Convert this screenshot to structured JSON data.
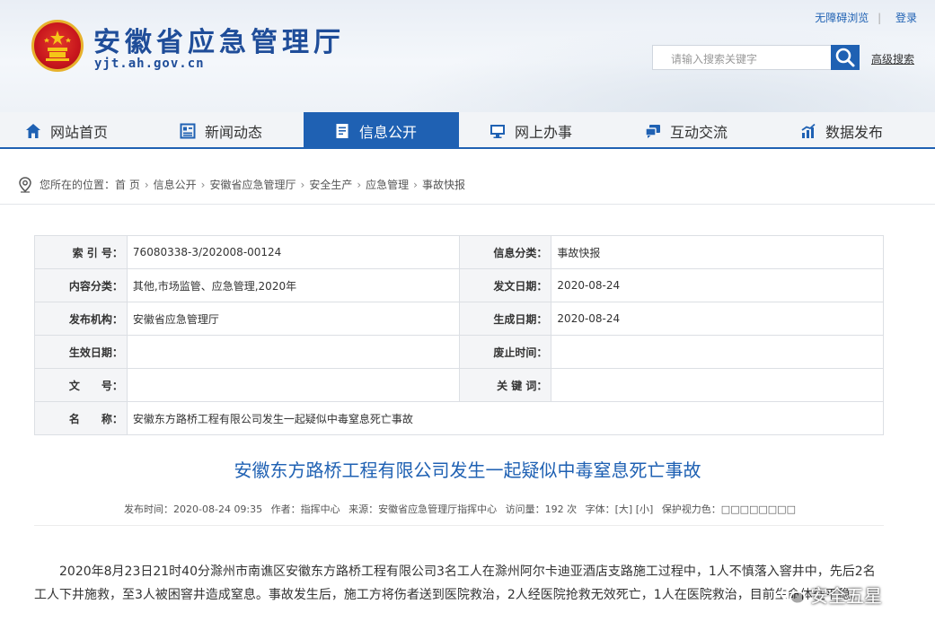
{
  "header": {
    "site_title": "安徽省应急管理厅",
    "site_url": "yjt.ah.gov.cn",
    "top_links": [
      "无障碍浏览",
      "登录"
    ],
    "search_placeholder": "请输入搜索关键字",
    "advanced_search": "高级搜索",
    "brand_color": "#1f61b3"
  },
  "nav": {
    "items": [
      {
        "label": "网站首页",
        "icon": "home-icon"
      },
      {
        "label": "新闻动态",
        "icon": "news-icon"
      },
      {
        "label": "信息公开",
        "icon": "document-icon",
        "active": true
      },
      {
        "label": "网上办事",
        "icon": "monitor-icon"
      },
      {
        "label": "互动交流",
        "icon": "chat-icon"
      },
      {
        "label": "数据发布",
        "icon": "chart-icon"
      }
    ]
  },
  "breadcrumb": {
    "prefix": "您所在的位置：",
    "items": [
      "首 页",
      "信息公开",
      "安徽省应急管理厅",
      "安全生产",
      "应急管理",
      "事故快报"
    ],
    "separator": "›"
  },
  "meta": {
    "index_no_label": "索 引 号：",
    "index_no": "76080338-3/202008-00124",
    "category_label": "信息分类：",
    "category": "事故快报",
    "content_label": "内容分类：",
    "content": "其他,市场监管、应急管理,2020年",
    "issue_date_label": "发文日期：",
    "issue_date": "2020-08-24",
    "publisher_label": "发布机构：",
    "publisher": "安徽省应急管理厅",
    "gen_date_label": "生成日期：",
    "gen_date": "2020-08-24",
    "effective_label": "生效日期：",
    "effective": "",
    "expire_label": "废止时间：",
    "expire": "",
    "doc_no_label": "文　　号：",
    "doc_no": "",
    "keywords_label": "关 键 词：",
    "keywords": "",
    "name_label": "名　　称：",
    "name": "安徽东方路桥工程有限公司发生一起疑似中毒窒息死亡事故"
  },
  "article": {
    "title": "安徽东方路桥工程有限公司发生一起疑似中毒窒息死亡事故",
    "publish_time": "发布时间：2020-08-24 09:35",
    "author": "作者：指挥中心",
    "source": "来源：安徽省应急管理厅指挥中心",
    "views": "访问量：192 次",
    "font_size": "字体：[大] [小]",
    "protect": "保护视力色：□□□□□□□□",
    "body": "2020年8月23日21时40分滁州市南谯区安徽东方路桥工程有限公司3名工人在滁州阿尔卡迪亚酒店支路施工过程中，1人不慎落入窨井中，先后2名工人下井施救，至3人被困窨井造成窒息。事故发生后，施工方将伤者送到医院救治，2人经医院抢救无效死亡，1人在医院救治，目前生命体征平稳。"
  },
  "watermark": {
    "text": "安全五星"
  }
}
